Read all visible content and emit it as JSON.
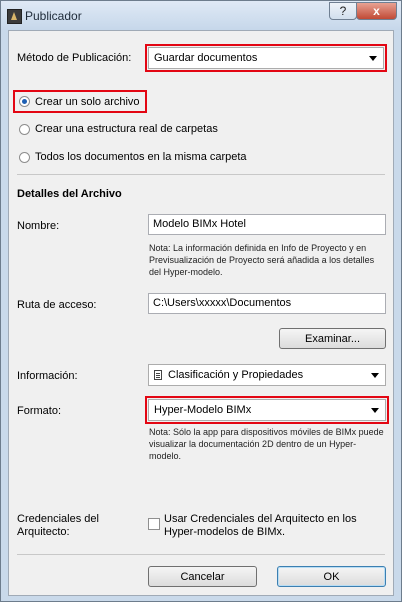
{
  "window": {
    "title": "Publicador",
    "help_label": "?",
    "close_label": "x"
  },
  "publish": {
    "label": "Método de Publicación:",
    "value": "Guardar documentos"
  },
  "options": [
    {
      "label": "Crear un solo archivo",
      "checked": true
    },
    {
      "label": "Crear una estructura real de carpetas",
      "checked": false
    },
    {
      "label": "Todos los documentos en la misma carpeta",
      "checked": false
    }
  ],
  "details": {
    "heading": "Detalles del Archivo",
    "name_label": "Nombre:",
    "name_value": "Modelo BIMx Hotel",
    "name_note": "Nota: La información definida en Info de Proyecto y en Previsualización de Proyecto será añadida a los detalles del Hyper-modelo.",
    "path_label": "Ruta de acceso:",
    "path_value": "C:\\Users\\xxxxx\\Documentos",
    "browse_label": "Examinar...",
    "info_label": "Información:",
    "info_value": "Clasificación y Propiedades",
    "format_label": "Formato:",
    "format_value": "Hyper-Modelo BIMx",
    "format_note": "Nota: Sólo la app para dispositivos móviles de BIMx puede visualizar la documentación 2D dentro de un Hyper-modelo.",
    "credentials_label": "Credenciales del Arquitecto:",
    "credentials_checkbox_label": "Usar Credenciales del Arquitecto en los Hyper-modelos de BIMx.",
    "credentials_checked": false
  },
  "footer": {
    "cancel_label": "Cancelar",
    "ok_label": "OK"
  },
  "colors": {
    "highlight": "#e30613",
    "titlebar": "#c9d9ea",
    "close_button": "#c14a36"
  }
}
